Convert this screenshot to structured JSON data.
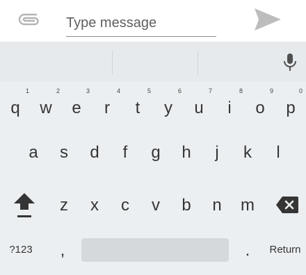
{
  "compose": {
    "placeholder": "Type message",
    "value": "",
    "attach_icon": "paperclip-icon",
    "send_icon": "send-icon"
  },
  "keyboard": {
    "mic_icon": "microphone-icon",
    "row1": [
      {
        "key": "q",
        "hint": "1"
      },
      {
        "key": "w",
        "hint": "2"
      },
      {
        "key": "e",
        "hint": "3"
      },
      {
        "key": "r",
        "hint": "4"
      },
      {
        "key": "t",
        "hint": "5"
      },
      {
        "key": "y",
        "hint": "6"
      },
      {
        "key": "u",
        "hint": "7"
      },
      {
        "key": "i",
        "hint": "8"
      },
      {
        "key": "o",
        "hint": "9"
      },
      {
        "key": "p",
        "hint": "0"
      }
    ],
    "row2": [
      "a",
      "s",
      "d",
      "f",
      "g",
      "h",
      "j",
      "k",
      "l"
    ],
    "row3": [
      "z",
      "x",
      "c",
      "v",
      "b",
      "n",
      "m"
    ],
    "shift_icon": "shift-arrow-icon",
    "backspace_icon": "backspace-icon",
    "symbols_label": "?123",
    "comma_label": ",",
    "period_label": ".",
    "return_label": "Return"
  }
}
